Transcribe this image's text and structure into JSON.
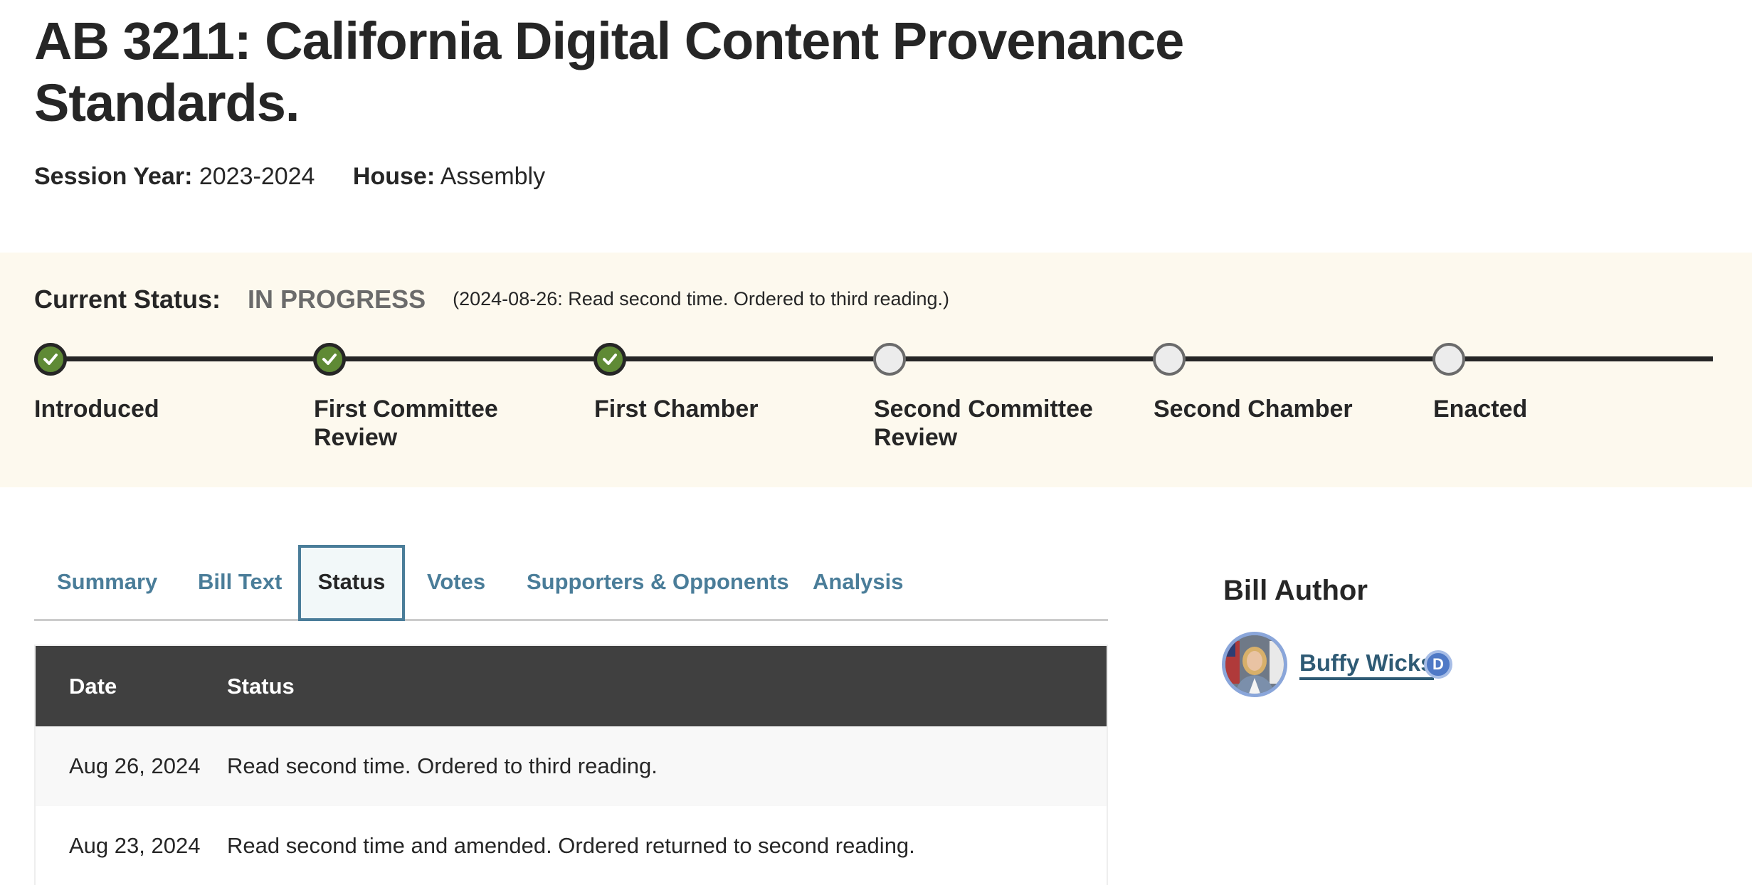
{
  "bill": {
    "title": "AB 3211: California Digital Content Provenance Standards.",
    "session_year_label": "Session Year:",
    "session_year": "2023-2024",
    "house_label": "House:",
    "house": "Assembly"
  },
  "status_band": {
    "current_label": "Current Status:",
    "current_state": "IN PROGRESS",
    "current_note": "(2024-08-26: Read second time. Ordered to third reading.)",
    "stages": [
      {
        "label": "Introduced",
        "state": "complete",
        "icon": "check-icon"
      },
      {
        "label": "First Committee Review",
        "state": "complete",
        "icon": "check-icon"
      },
      {
        "label": "First Chamber",
        "state": "complete",
        "icon": "check-icon"
      },
      {
        "label": "Second Committee Review",
        "state": "pending",
        "icon": "empty-circle-icon"
      },
      {
        "label": "Second Chamber",
        "state": "pending",
        "icon": "empty-circle-icon"
      },
      {
        "label": "Enacted",
        "state": "pending",
        "icon": "empty-circle-icon"
      }
    ]
  },
  "tabs": [
    {
      "label": "Summary",
      "active": false
    },
    {
      "label": "Bill Text",
      "active": false
    },
    {
      "label": "Status",
      "active": true
    },
    {
      "label": "Votes",
      "active": false
    },
    {
      "label": "Supporters & Opponents",
      "active": false
    },
    {
      "label": "Analysis",
      "active": false
    }
  ],
  "status_table": {
    "columns": [
      "Date",
      "Status"
    ],
    "rows": [
      {
        "date": "Aug 26, 2024",
        "status": "Read second time. Ordered to third reading."
      },
      {
        "date": "Aug 23, 2024",
        "status": "Read second time and amended. Ordered returned to second reading."
      }
    ]
  },
  "author": {
    "heading": "Bill Author",
    "name": "Buffy Wicks",
    "party": "D",
    "avatar_icon": "author-photo"
  },
  "colors": {
    "complete": "#5f8a35",
    "pending": "#ececec",
    "link": "#4a7d99",
    "band_bg": "#fdf9ee",
    "table_header": "#404040",
    "party_badge": "#4f79c6"
  }
}
